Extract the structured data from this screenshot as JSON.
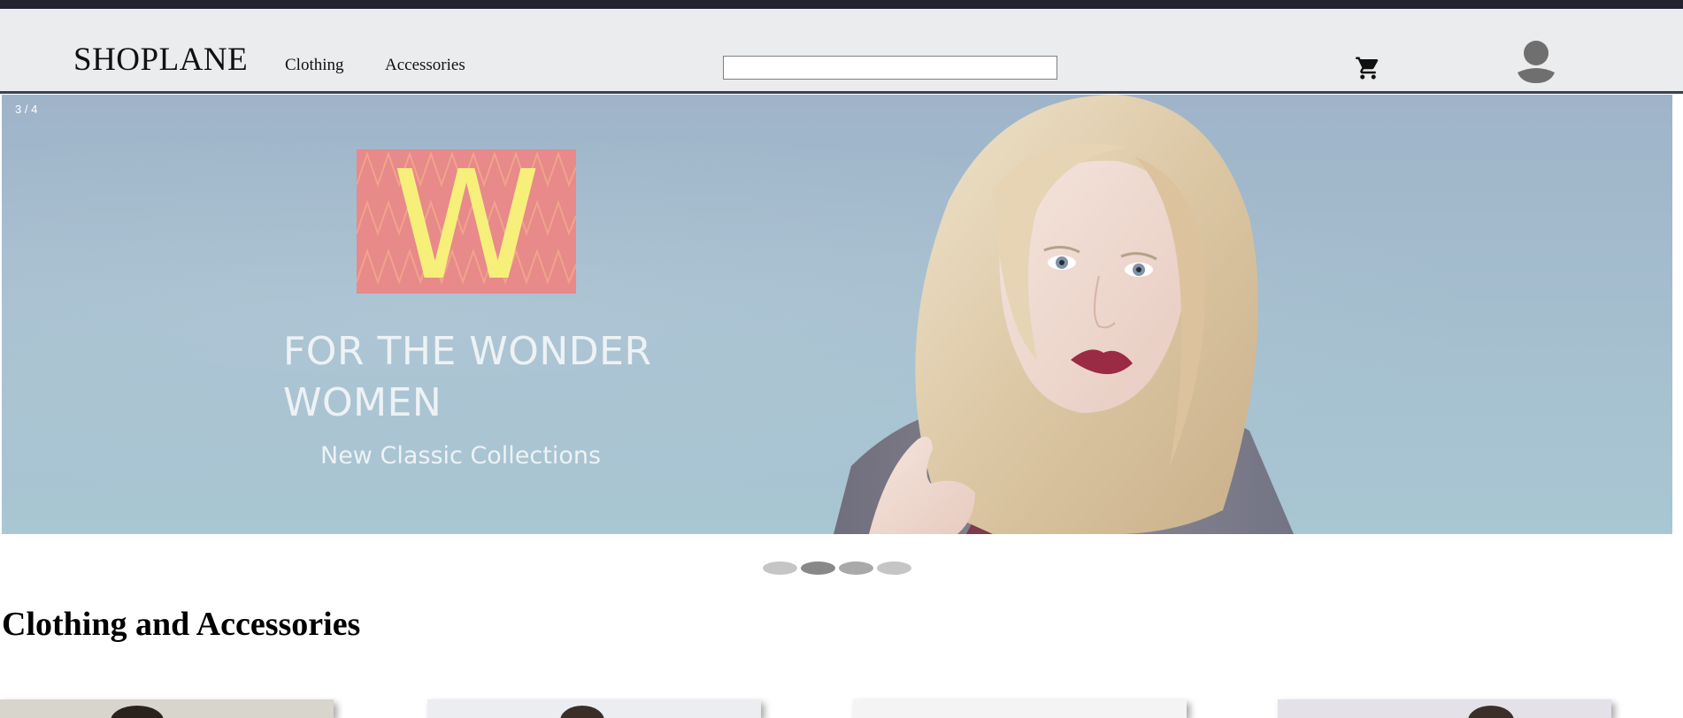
{
  "header": {
    "logo": "SHOPLANE",
    "nav": [
      "Clothing",
      "Accessories"
    ],
    "search": {
      "value": "",
      "placeholder": ""
    },
    "icons": {
      "cart": "shopping-cart-icon",
      "profile": "user-avatar-icon"
    }
  },
  "hero": {
    "slide_counter": "3 / 4",
    "badge_letter": "W",
    "headline_line1": "FOR THE WONDER",
    "headline_line2": "WOMEN",
    "subheadline": "New Classic Collections",
    "current_slide": 3,
    "total_slides": 4
  },
  "section": {
    "title": "Clothing and Accessories"
  },
  "colors": {
    "header_bg": "#ebecee",
    "top_strip": "#232330",
    "badge_pink": "#e8898a",
    "badge_letter": "#f6f07a",
    "dot_active": "#888888",
    "dot_inactive": "#c5c5c5"
  }
}
